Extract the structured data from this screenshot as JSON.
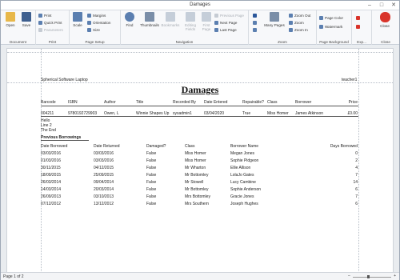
{
  "window": {
    "title": "Damages"
  },
  "ribbon": {
    "document": {
      "label": "Document",
      "open": "Open",
      "save": "Save"
    },
    "print": {
      "label": "Print",
      "print": "Print",
      "quick_print": "Quick Print",
      "parameters": "Parameters"
    },
    "page_setup": {
      "label": "Page Setup",
      "scale": "Scale",
      "margins": "Margins",
      "orientation": "Orientation",
      "size": "Size"
    },
    "navigation": {
      "label": "Navigation",
      "find": "Find",
      "thumbnails": "Thumbnails",
      "bookmarks": "Bookmarks",
      "editing_fields": "Editing Fields",
      "first_page": "First Page",
      "previous_page": "Previous Page",
      "next_page": "Next Page",
      "last_page": "Last Page"
    },
    "zoom": {
      "label": "Zoom",
      "many_pages": "Many Pages",
      "zoom_out": "Zoom Out",
      "zoom": "Zoom",
      "zoom_in": "Zoom In"
    },
    "page_background": {
      "label": "Page Background",
      "page_color": "Page Color",
      "watermark": "Watermark"
    },
    "export": {
      "label": "Exp..."
    },
    "close": {
      "label": "Close",
      "close": "Close"
    }
  },
  "report": {
    "header_left": "Spherical Software Laptop",
    "header_right": "teacher1",
    "title": "Damages",
    "columns": [
      "Barcode",
      "ISBN",
      "Author",
      "Title",
      "Recorded By",
      "Date Entered",
      "Repairable?",
      "Class",
      "Borrower",
      "Price"
    ],
    "record": [
      "004211",
      "9780192729903",
      "Owen, L",
      "Winnie Shapes Up",
      "sysadmin1",
      "03/04/2020",
      "True",
      "Miss Homer",
      "James Atkinson",
      "£0.00"
    ],
    "notes": [
      "Hello",
      "Line 2",
      "The End"
    ],
    "prev_title": "Previous Borrowings",
    "prev_columns": [
      "Date Borrowed",
      "Date Returned",
      "Damaged?",
      "Class",
      "Borrower Name",
      "Days Borrowed"
    ],
    "prev_rows": [
      [
        "03/03/2016",
        "03/03/2016",
        "False",
        "Miss Homer",
        "Megan Jones",
        "0"
      ],
      [
        "01/03/2016",
        "03/03/2016",
        "False",
        "Miss Homer",
        "Sophie Pidgeon",
        "2"
      ],
      [
        "30/11/2015",
        "04/12/2015",
        "False",
        "Mr Wharton",
        "Ellie Allison",
        "4"
      ],
      [
        "18/09/2015",
        "25/09/2015",
        "False",
        "Mr Bottomley",
        "LolaJo Gates",
        "7"
      ],
      [
        "26/03/2014",
        "09/04/2014",
        "False",
        "Mr Stowell",
        "Lucy Cambine",
        "14"
      ],
      [
        "14/03/2014",
        "20/03/2014",
        "False",
        "Mr Bottomley",
        "Sophie Anderson",
        "6"
      ],
      [
        "26/09/2013",
        "03/10/2013",
        "False",
        "Mrs Bottomley",
        "Gracie Jones",
        "7"
      ],
      [
        "07/12/2012",
        "13/12/2012",
        "False",
        "Mrs Southern",
        "Joseph Hughes",
        "6"
      ]
    ]
  },
  "status": {
    "page": "Page 1 of 2",
    "zoom_percent": 40
  },
  "colors": {
    "accent": "#2b579a",
    "close_red": "#d9342b"
  }
}
